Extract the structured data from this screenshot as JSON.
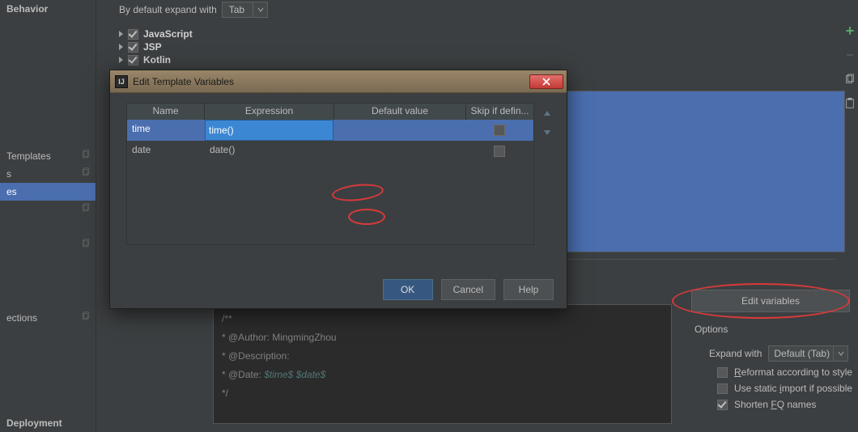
{
  "sidebar": {
    "items": [
      {
        "label": "Behavior"
      },
      {
        "label": "Templates",
        "suffix": "Templates"
      },
      {
        "label": "s"
      },
      {
        "label": "es"
      },
      {
        "label": ""
      },
      {
        "label": ""
      },
      {
        "label": "ections"
      }
    ],
    "bottom_label": "Deployment"
  },
  "main": {
    "expand_label": "By default expand with",
    "expand_value": "Tab",
    "languages": [
      {
        "label": "JavaScript",
        "checked": true
      },
      {
        "label": "JSP",
        "checked": true
      },
      {
        "label": "Kotlin",
        "checked": true
      }
    ]
  },
  "template_code": {
    "l1": "/**",
    "l2": " * @Author: MingmingZhou",
    "l3": " * @Description:",
    "l4_a": " * @Date: ",
    "l4_v1": "$time$",
    "l4_sp": " ",
    "l4_v2": "$date$",
    "l5": " */"
  },
  "right": {
    "edit_vars_label": "Edit variables",
    "options_label": "Options",
    "expand_with_label": "Expand with",
    "expand_with_value": "Default (Tab)",
    "reformat_label": "Reformat according to style",
    "use_static_label": "Use static import if possible",
    "shorten_label": "Shorten FQ names"
  },
  "modal": {
    "title": "Edit Template Variables",
    "cols": {
      "name": "Name",
      "expr": "Expression",
      "def": "Default value",
      "skip": "Skip if defin..."
    },
    "rows": [
      {
        "name": "time",
        "expr": "time()",
        "def": "",
        "skip": false
      },
      {
        "name": "date",
        "expr": "date()",
        "def": "",
        "skip": false
      }
    ],
    "buttons": {
      "ok": "OK",
      "cancel": "Cancel",
      "help": "Help"
    }
  }
}
